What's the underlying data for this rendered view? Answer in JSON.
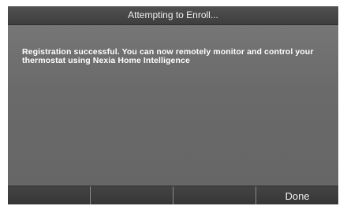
{
  "title_bar": {
    "title": "Attempting to Enroll..."
  },
  "content": {
    "message": "Registration successful. You can now remotely monitor and control your thermostat using Nexia Home Intelligence"
  },
  "softkeys": [
    {
      "label": ""
    },
    {
      "label": ""
    },
    {
      "label": ""
    },
    {
      "label": "Done"
    }
  ],
  "colors": {
    "screen_background": "#6b6b6b",
    "title_bar_background": "#454545",
    "softkey_bar_background": "#3c3c3c",
    "text": "#ffffff"
  }
}
